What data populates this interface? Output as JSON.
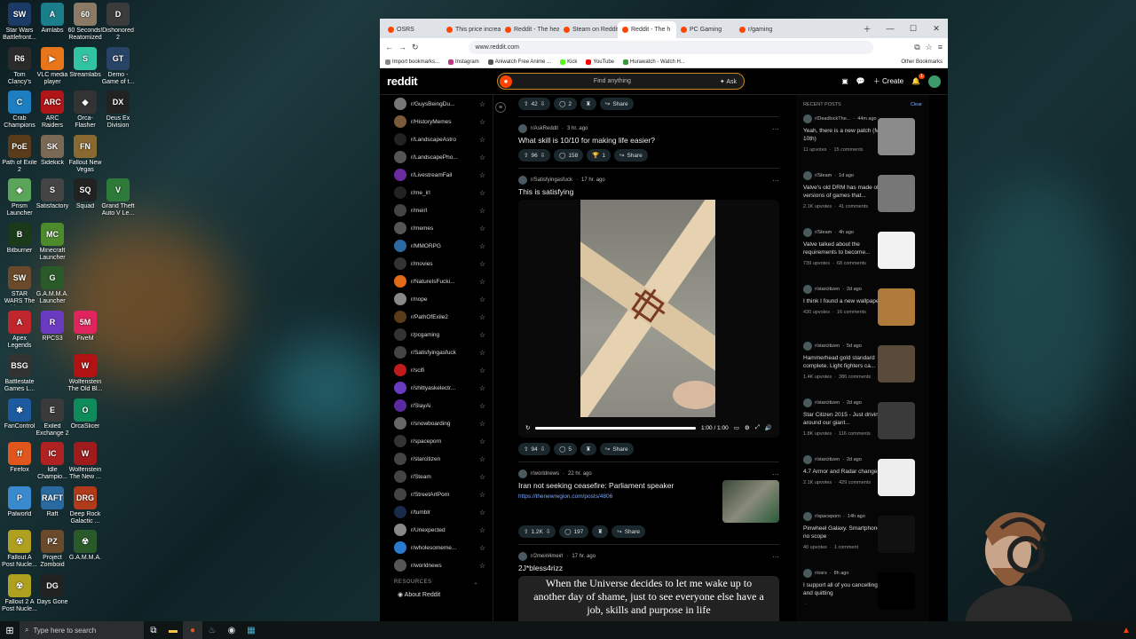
{
  "desktop": {
    "icons": [
      {
        "label": "Star Wars Battlefront...",
        "color": "#1b3a66",
        "glyph": "SW",
        "col": 0,
        "row": 0
      },
      {
        "label": "Aimlabs",
        "color": "#1a7f8a",
        "glyph": "A",
        "col": 1,
        "row": 0
      },
      {
        "label": "60 Seconds! Reatomized",
        "color": "#8a7a66",
        "glyph": "60",
        "col": 2,
        "row": 0
      },
      {
        "label": "Dishonored 2",
        "color": "#3b3b3b",
        "glyph": "D",
        "col": 3,
        "row": 0
      },
      {
        "label": "Tom Clancy's Rainbow Si...",
        "color": "#2b2b2b",
        "glyph": "R6",
        "col": 0,
        "row": 1
      },
      {
        "label": "VLC media player",
        "color": "#e8751a",
        "glyph": "▶",
        "col": 1,
        "row": 1
      },
      {
        "label": "Streamlabs",
        "color": "#31c3a2",
        "glyph": "S",
        "col": 2,
        "row": 1
      },
      {
        "label": "Demo - Game of t...",
        "color": "#274466",
        "glyph": "GT",
        "col": 3,
        "row": 1
      },
      {
        "label": "Crab Champions",
        "color": "#1d7fc1",
        "glyph": "C",
        "col": 0,
        "row": 2
      },
      {
        "label": "ARC Raiders",
        "color": "#b01616",
        "glyph": "ARC",
        "col": 1,
        "row": 2
      },
      {
        "label": "Orca-Flasher",
        "color": "#333",
        "glyph": "◆",
        "col": 2,
        "row": 2
      },
      {
        "label": "Deus Ex Division",
        "color": "#222",
        "glyph": "DX",
        "col": 3,
        "row": 2
      },
      {
        "label": "Path of Exile 2",
        "color": "#5a3b1a",
        "glyph": "PoE",
        "col": 0,
        "row": 3
      },
      {
        "label": "Sidekick",
        "color": "#7a6a55",
        "glyph": "SK",
        "col": 1,
        "row": 3
      },
      {
        "label": "Fallout New Vegas",
        "color": "#8a6a30",
        "glyph": "FN",
        "col": 2,
        "row": 3
      },
      {
        "label": "Prism Launcher",
        "color": "#5aa55a",
        "glyph": "◈",
        "col": 0,
        "row": 4
      },
      {
        "label": "Satisfactory",
        "color": "#444",
        "glyph": "S",
        "col": 1,
        "row": 4
      },
      {
        "label": "Squad",
        "color": "#222",
        "glyph": "SQ",
        "col": 2,
        "row": 4
      },
      {
        "label": "Grand Theft Auto V Le...",
        "color": "#2d7a3a",
        "glyph": "V",
        "col": 3,
        "row": 4
      },
      {
        "label": "Bitburner",
        "color": "#1a3a1a",
        "glyph": "B",
        "col": 0,
        "row": 5
      },
      {
        "label": "Minecraft Launcher",
        "color": "#4c8a2c",
        "glyph": "MC",
        "col": 1,
        "row": 5
      },
      {
        "label": "STAR WARS The Old Rep...",
        "color": "#6a4a2a",
        "glyph": "SW",
        "col": 0,
        "row": 6
      },
      {
        "label": "G.A.M.M.A. Launcher",
        "color": "#2a5a2a",
        "glyph": "G",
        "col": 1,
        "row": 6
      },
      {
        "label": "Apex Legends",
        "color": "#c0262b",
        "glyph": "A",
        "col": 0,
        "row": 7
      },
      {
        "label": "RPCS3",
        "color": "#6a3ac1",
        "glyph": "R",
        "col": 1,
        "row": 7
      },
      {
        "label": "FiveM",
        "color": "#e0245e",
        "glyph": "5M",
        "col": 2,
        "row": 7
      },
      {
        "label": "Battlestate Games L...",
        "color": "#333",
        "glyph": "BSG",
        "col": 0,
        "row": 8
      },
      {
        "label": "Wolfenstein The Old Bl...",
        "color": "#b31212",
        "glyph": "W",
        "col": 2,
        "row": 8
      },
      {
        "label": "FanControl",
        "color": "#1d5aa0",
        "glyph": "✱",
        "col": 0,
        "row": 9
      },
      {
        "label": "Exiled Exchange 2",
        "color": "#3a3a3a",
        "glyph": "E",
        "col": 1,
        "row": 9
      },
      {
        "label": "OrcaSlicer",
        "color": "#0f8a5a",
        "glyph": "O",
        "col": 2,
        "row": 9
      },
      {
        "label": "Firefox",
        "color": "#e0561c",
        "glyph": "ff",
        "col": 0,
        "row": 10
      },
      {
        "label": "Idle Champio...",
        "color": "#b02222",
        "glyph": "IC",
        "col": 1,
        "row": 10
      },
      {
        "label": "Wolfenstein The New ...",
        "color": "#a01b1b",
        "glyph": "W",
        "col": 2,
        "row": 10
      },
      {
        "label": "Palworld",
        "color": "#3a8ad0",
        "glyph": "P",
        "col": 0,
        "row": 11
      },
      {
        "label": "Raft",
        "color": "#2a6aa0",
        "glyph": "RAFT",
        "col": 1,
        "row": 11
      },
      {
        "label": "Deep Rock Galactic ...",
        "color": "#b03a1a",
        "glyph": "DRG",
        "col": 2,
        "row": 11
      },
      {
        "label": "Fallout A Post Nucle...",
        "color": "#b0a020",
        "glyph": "☢",
        "col": 0,
        "row": 12
      },
      {
        "label": "Project Zomboid",
        "color": "#6a4a2a",
        "glyph": "PZ",
        "col": 1,
        "row": 12
      },
      {
        "label": "G.A.M.M.A.",
        "color": "#2a5a2a",
        "glyph": "☢",
        "col": 2,
        "row": 12
      },
      {
        "label": "Fallout 2 A Post Nucle...",
        "color": "#b0a020",
        "glyph": "☢",
        "col": 0,
        "row": 13
      },
      {
        "label": "Days Gone",
        "color": "#222",
        "glyph": "DG",
        "col": 1,
        "row": 13
      }
    ]
  },
  "taskbar": {
    "search_placeholder": "Type here to search"
  },
  "browser": {
    "tabs": [
      {
        "label": "OSRS"
      },
      {
        "label": "This price increa"
      },
      {
        "label": "Reddit - The hea"
      },
      {
        "label": "Steam on Reddit"
      },
      {
        "label": "Reddit - The h",
        "active": true
      },
      {
        "label": "PC Gaming"
      },
      {
        "label": "r/gaming"
      }
    ],
    "url": "www.reddit.com",
    "bookmarks": [
      {
        "label": "Import bookmarks...",
        "color": "#888"
      },
      {
        "label": "Instagram",
        "color": "#c13584"
      },
      {
        "label": "Aniwatch Free Anime ...",
        "color": "#555"
      },
      {
        "label": "Kick",
        "color": "#53fc18"
      },
      {
        "label": "YouTube",
        "color": "#ff0000"
      },
      {
        "label": "Hurawatch - Watch H...",
        "color": "#3a9a3a"
      }
    ],
    "other_bookmarks": "Other Bookmarks"
  },
  "reddit": {
    "logo": "reddit",
    "search_placeholder": "Find anything",
    "ask_label": "Ask",
    "create_label": "Create",
    "notif_count": "1",
    "communities": [
      {
        "name": "r/GuysBeingDu...",
        "color": "#777"
      },
      {
        "name": "r/HistoryMemes",
        "color": "#7a5a3a"
      },
      {
        "name": "r/LandscapeAstro",
        "color": "#222"
      },
      {
        "name": "r/LandscapePho...",
        "color": "#555"
      },
      {
        "name": "r/LivestreamFail",
        "color": "#6a2aa0"
      },
      {
        "name": "r/me_irl",
        "color": "#222"
      },
      {
        "name": "r/meirl",
        "color": "#444"
      },
      {
        "name": "r/memes",
        "color": "#555"
      },
      {
        "name": "r/MMORPG",
        "color": "#2a6aa0"
      },
      {
        "name": "r/movies",
        "color": "#333"
      },
      {
        "name": "r/NatureIsFucki...",
        "color": "#e06a1a"
      },
      {
        "name": "r/nope",
        "color": "#888"
      },
      {
        "name": "r/PathOfExile2",
        "color": "#5a3b1a"
      },
      {
        "name": "r/pcgaming",
        "color": "#333"
      },
      {
        "name": "r/Satisfyingasfuck",
        "color": "#444"
      },
      {
        "name": "r/scifi",
        "color": "#c01a1a"
      },
      {
        "name": "r/shittyaskelectr...",
        "color": "#6a3ac1"
      },
      {
        "name": "r/SlayAi",
        "color": "#5a2aa0"
      },
      {
        "name": "r/snowboarding",
        "color": "#666"
      },
      {
        "name": "r/spaceporn",
        "color": "#333"
      },
      {
        "name": "r/starcitizen",
        "color": "#444"
      },
      {
        "name": "r/Steam",
        "color": "#444"
      },
      {
        "name": "r/StreetArtPorn",
        "color": "#444"
      },
      {
        "name": "r/tumblr",
        "color": "#1a2a4a"
      },
      {
        "name": "r/Unexpected",
        "color": "#888"
      },
      {
        "name": "r/wholesomeme...",
        "color": "#2a7ad0"
      },
      {
        "name": "r/worldnews",
        "color": "#555"
      }
    ],
    "resources_label": "RESOURCES",
    "about_label": "About Reddit",
    "top_actions": {
      "upvotes": "42",
      "comments": "2",
      "share": "Share"
    },
    "posts": [
      {
        "sub": "r/AskReddit",
        "time": "3 hr. ago",
        "title": "What skill is 10/10 for making life easier?",
        "upvotes": "96",
        "comments": "158",
        "award": "1",
        "share": "Share"
      },
      {
        "sub": "r/Satisfyingasfuck",
        "time": "17 hr. ago",
        "title": "This is satisfying",
        "upvotes": "94",
        "comments": "5",
        "share": "Share",
        "video_time": "1:00 / 1:00",
        "progress": 1.0
      },
      {
        "sub": "r/worldnews",
        "time": "22 hr. ago",
        "title": "Iran not seeking ceasefire: Parliament speaker",
        "link": "https://thenewregion.com/posts/4806",
        "upvotes": "1.2K",
        "comments": "197",
        "share": "Share"
      },
      {
        "sub": "r/2meirl4meirl",
        "time": "17 hr. ago",
        "title": "2J*bless4rizz"
      }
    ],
    "recent": {
      "title": "RECENT POSTS",
      "clear": "Clear",
      "items": [
        {
          "sub": "r/DeadlockThe...",
          "time": "44m ago",
          "title": "Yeah, there is a new patch (Mar 10th)",
          "upvotes": "11 upvotes",
          "comments": "15 comments",
          "thumb": "#8a8a8a"
        },
        {
          "sub": "r/Steam",
          "time": "1d ago",
          "title": "Valve's old DRM has made old versions of games that...",
          "upvotes": "2.1K upvotes",
          "comments": "41 comments",
          "thumb": "#777"
        },
        {
          "sub": "r/Steam",
          "time": "4h ago",
          "title": "Valve talked about the requirements to become...",
          "upvotes": "739 upvotes",
          "comments": "68 comments",
          "thumb": "#f2f2f2"
        },
        {
          "sub": "r/starcitizen",
          "time": "2d ago",
          "title": "I think I found a new wallpaper",
          "upvotes": "430 upvotes",
          "comments": "16 comments",
          "thumb": "#b07a3a"
        },
        {
          "sub": "r/starcitizen",
          "time": "5d ago",
          "title": "Hammerhead gold standard complete. Light fighters ca...",
          "upvotes": "1.4K upvotes",
          "comments": "386 comments",
          "thumb": "#5a4a3a"
        },
        {
          "sub": "r/starcitizen",
          "time": "2d ago",
          "title": "Star Citizen 2015 - Just driving around our giant...",
          "upvotes": "1.8K upvotes",
          "comments": "116 comments",
          "thumb": "#3a3a3a"
        },
        {
          "sub": "r/starcitizen",
          "time": "2d ago",
          "title": "4.7 Armor and Radar changes",
          "upvotes": "2.1K upvotes",
          "comments": "429 comments",
          "thumb": "#eee"
        },
        {
          "sub": "r/spaceporn",
          "time": "14h ago",
          "title": "Pinwheel Galaxy. Smartphone, no scope",
          "upvotes": "40 upvotes",
          "comments": "1 comment",
          "thumb": "#111"
        },
        {
          "sub": "r/osrs",
          "time": "8h ago",
          "title": "I support all of you cancelling and quitting",
          "upvotes": "",
          "comments": "",
          "thumb": "#000"
        }
      ]
    }
  },
  "caption": "When the Universe decides to let me wake up to another day of shame, just to see everyone else have a job, skills and purpose in life",
  "colors": {
    "reddit_orange": "#ff4500",
    "link_blue": "#7aa7ff"
  }
}
